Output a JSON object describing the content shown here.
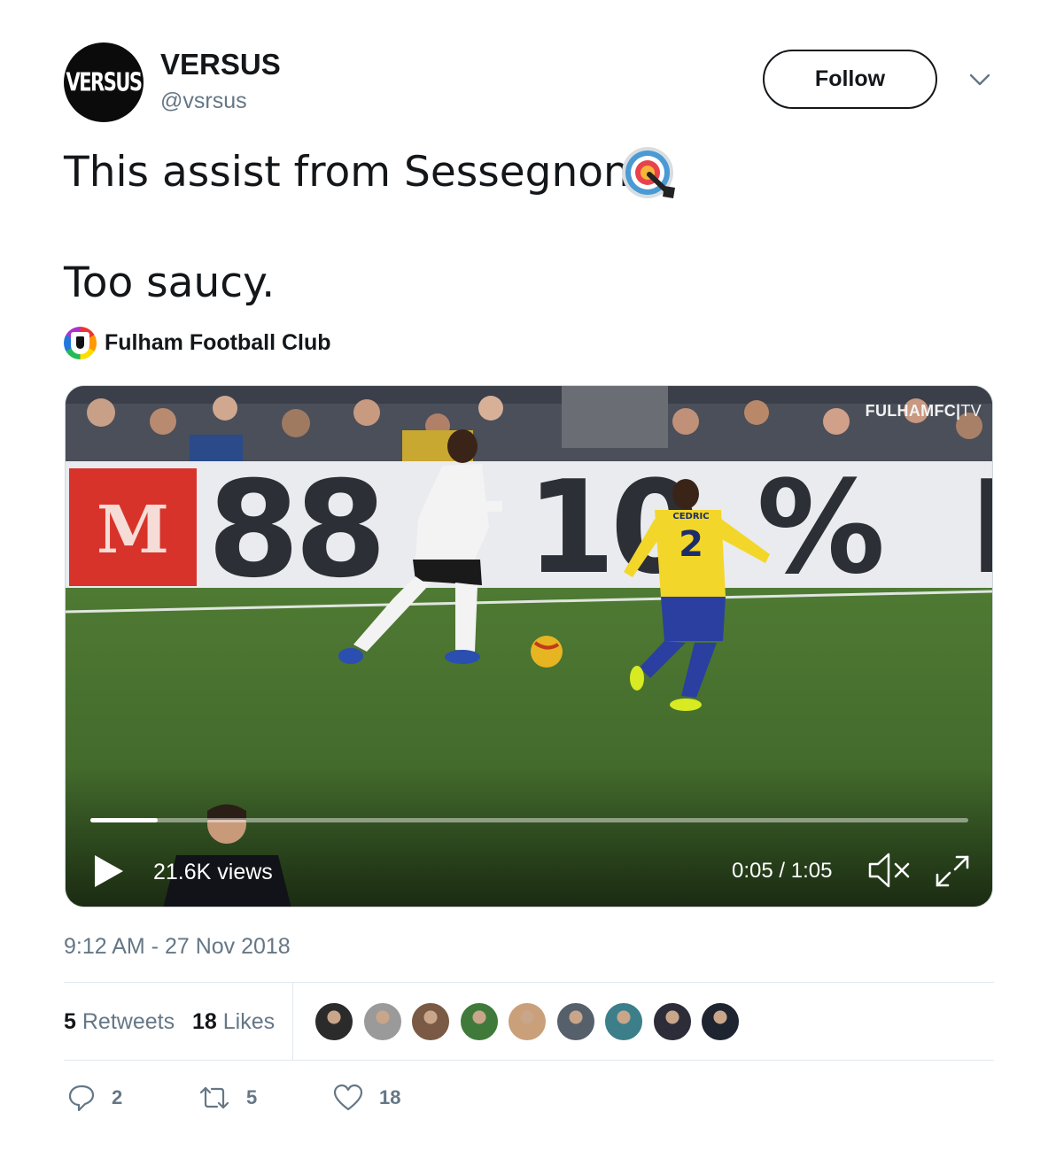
{
  "author": {
    "avatar_text": "VERSUS",
    "display_name": "VERSUS",
    "handle": "@vsrsus",
    "follow_label": "Follow"
  },
  "tweet": {
    "line1": "This assist from Sessegnon",
    "line2": "Too saucy.",
    "emoji": "direct-hit-target-icon"
  },
  "attribution": {
    "name": "Fulham Football Club"
  },
  "video": {
    "watermark_brand": "FULHAMFC",
    "watermark_suffix": "TV",
    "board_text": "88        10 %",
    "jersey_name": "CEDRIC",
    "jersey_number": "2",
    "views": "21.6K views",
    "time": "0:05 / 1:05",
    "progress": 0.077
  },
  "timestamp": "9:12 AM - 27 Nov 2018",
  "stats": {
    "retweets_count": "5",
    "retweets_label": "Retweets",
    "likes_count": "18",
    "likes_label": "Likes"
  },
  "likers_colors": [
    "#2b2b2b",
    "#9a9a9a",
    "#7a5a44",
    "#3f7a3a",
    "#c9a07a",
    "#55606a",
    "#3c7f8a",
    "#2d2d3a",
    "#1e2430"
  ],
  "actions": {
    "reply_count": "2",
    "retweet_count": "5",
    "like_count": "18"
  },
  "colors": {
    "text": "#14171a",
    "secondary": "#657786",
    "border": "#e1e8ed"
  }
}
